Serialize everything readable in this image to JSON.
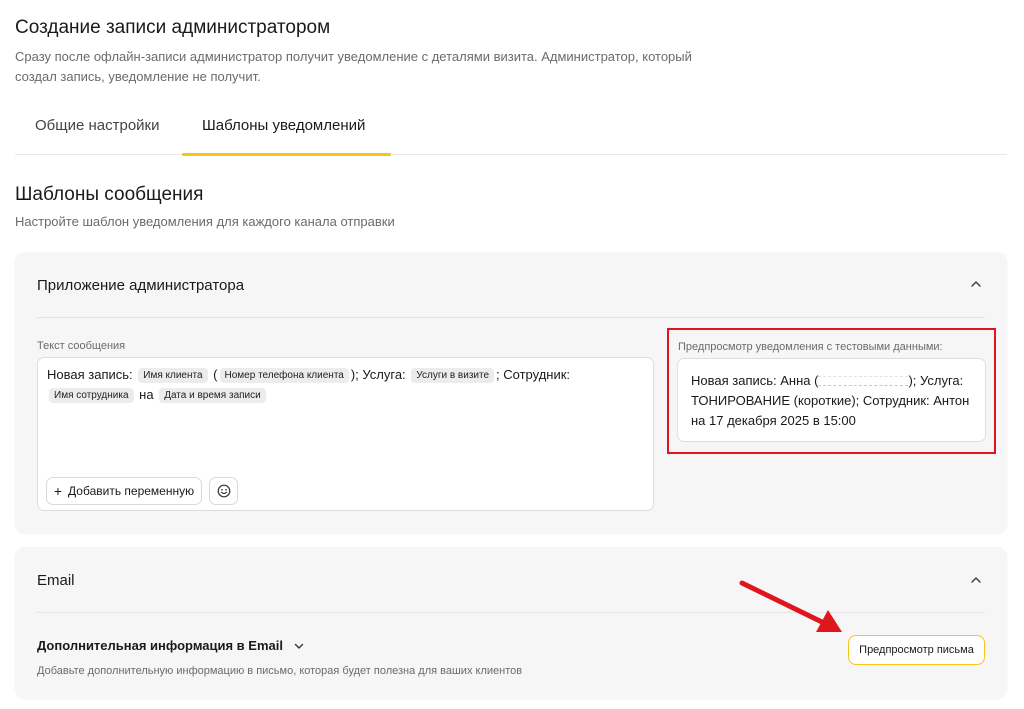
{
  "page": {
    "title": "Создание записи администратором",
    "description": "Сразу после офлайн-записи администратор получит уведомление с деталями визита. Администратор, который создал запись, уведомление не получит."
  },
  "tabs": [
    {
      "label": "Общие настройки",
      "active": false
    },
    {
      "label": "Шаблоны уведомлений",
      "active": true
    }
  ],
  "section": {
    "title": "Шаблоны сообщения",
    "description": "Настройте шаблон уведомления для каждого канала отправки"
  },
  "admin_card": {
    "title": "Приложение администратора",
    "field_label": "Текст сообщения",
    "template": {
      "t1": "Новая запись:",
      "v_client": "Имя клиента",
      "t2": "(",
      "v_phone": "Номер телефона клиента",
      "t3": "); Услуга:",
      "v_services": "Услуги в визите",
      "t4": "; Сотрудник:",
      "v_employee": "Имя сотрудника",
      "t5": "на",
      "v_datetime": "Дата и время записи"
    },
    "add_variable_label": "Добавить переменную",
    "preview_label": "Предпросмотр уведомления с тестовыми данными:",
    "preview": {
      "p1": "Новая запись: Анна (",
      "p2": "); Услуга: ТОНИРОВАНИЕ (короткие); Сотрудник: Антон на 17 декабря 2025 в 15:00"
    }
  },
  "email_card": {
    "title": "Email",
    "extra_info_label": "Дополнительная информация в Email",
    "extra_info_desc": "Добавьте дополнительную информацию в письмо, которая будет полезна для ваших клиентов",
    "preview_button_label": "Предпросмотр письма"
  },
  "colors": {
    "accent": "#f5c518",
    "highlight_red": "#e0161e",
    "card_bg": "#f6f6f7"
  }
}
